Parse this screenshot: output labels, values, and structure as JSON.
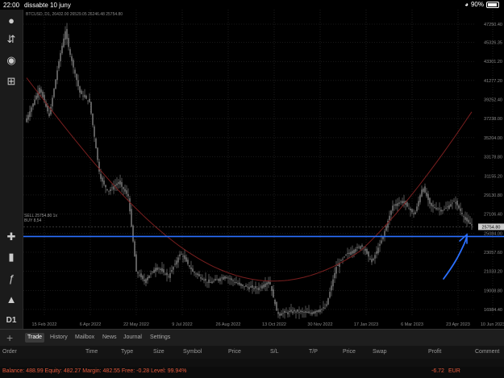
{
  "status_bar": {
    "time": "22:00",
    "date": "dissabte 10 juny",
    "battery": "90%"
  },
  "left_toolbar": {
    "timeframe": "D1",
    "icons": [
      "account-icon",
      "trade-arrows-icon",
      "chat-icon",
      "add-chart-icon",
      "crosshair-icon",
      "candles-icon",
      "function-icon",
      "objects-icon"
    ]
  },
  "chart": {
    "symbol_info": "BTCUSD, D1, 26432.00 26529.05 26246.48 25754.80",
    "left_labels": [
      "SELL 25754.80 1x",
      "BUY 8,54"
    ],
    "price_axis": [
      "47250.40",
      "45326.35",
      "43301.20",
      "41277.20",
      "39252.40",
      "37238.00",
      "35204.00",
      "33178.80",
      "31155.20",
      "29130.80",
      "27106.40",
      "25084.00",
      "23057.60",
      "21033.20",
      "19008.80",
      "16984.40"
    ],
    "current_price": "25754.80",
    "date_axis": [
      "15 Feb 2022",
      "6 Apr 2022",
      "22 May 2022",
      "9 Jul 2022",
      "26 Aug 2022",
      "13 Oct 2022",
      "30 Nov 2022",
      "17 Jan 2023",
      "6 Mar 2023",
      "23 Apr 2023",
      "10 Jun 2023"
    ],
    "colors": {
      "moving_average": "#7a1f1f",
      "hline": "#2a6fff",
      "annotation": "#2a6fff",
      "price_tag": "#cccccc"
    }
  },
  "tabs": {
    "add": "+",
    "items": [
      "Trade",
      "History",
      "Mailbox",
      "News",
      "Journal",
      "Settings"
    ],
    "active": "Trade"
  },
  "columns": [
    "Order",
    "Time",
    "Type",
    "Size",
    "Symbol",
    "Price",
    "S/L",
    "T/P",
    "Price",
    "Swap",
    "Profit",
    "Comment"
  ],
  "footer": {
    "balance_text": "Balance: 488.99 Equity: 482.27 Margin: 482.55 Free: -0.28 Level: 99.94%",
    "profit": "-6.72",
    "currency": "EUR"
  }
}
